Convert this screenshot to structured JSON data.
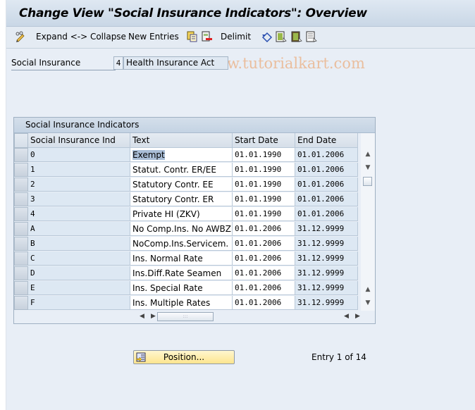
{
  "window": {
    "title": "Change View \"Social Insurance Indicators\": Overview"
  },
  "toolbar": {
    "items": [
      {
        "icon": "pencil-glasses-icon",
        "label": ""
      },
      {
        "label": "Expand <-> Collapse"
      },
      {
        "label": "New Entries"
      },
      {
        "icon": "copy-icon",
        "label": ""
      },
      {
        "icon": "delete-icon",
        "label": ""
      },
      {
        "label": "Delimit"
      },
      {
        "icon": "undo-icon",
        "label": ""
      },
      {
        "icon": "select-all-icon",
        "label": ""
      },
      {
        "icon": "select-block-icon",
        "label": ""
      },
      {
        "icon": "deselect-all-icon",
        "label": ""
      }
    ],
    "expand_collapse_label": "Expand <-> Collapse",
    "new_entries_label": "New Entries",
    "delimit_label": "Delimit"
  },
  "watermark": "©www.tutorialkart.com",
  "header_field": {
    "label": "Social Insurance",
    "key": "4",
    "value": "Health Insurance Act"
  },
  "table": {
    "title": "Social Insurance Indicators",
    "columns": [
      "Social Insurance Ind",
      "Text",
      "Start Date",
      "End Date"
    ],
    "rows": [
      {
        "ind": "0",
        "text": "Exempt",
        "start": "01.01.1990",
        "end": "01.01.2006"
      },
      {
        "ind": "1",
        "text": "Statut. Contr. ER/EE",
        "start": "01.01.1990",
        "end": "01.01.2006"
      },
      {
        "ind": "2",
        "text": "Statutory Contr. EE",
        "start": "01.01.1990",
        "end": "01.01.2006"
      },
      {
        "ind": "3",
        "text": "Statutory Contr. ER",
        "start": "01.01.1990",
        "end": "01.01.2006"
      },
      {
        "ind": "4",
        "text": "Private HI (ZKV)",
        "start": "01.01.1990",
        "end": "01.01.2006"
      },
      {
        "ind": "A",
        "text": "No Comp.Ins. No AWBZ",
        "start": "01.01.2006",
        "end": "31.12.9999"
      },
      {
        "ind": "B",
        "text": "NoComp.Ins.Servicem.",
        "start": "01.01.2006",
        "end": "31.12.9999"
      },
      {
        "ind": "C",
        "text": "Ins. Normal Rate",
        "start": "01.01.2006",
        "end": "31.12.9999"
      },
      {
        "ind": "D",
        "text": "Ins.Diff.Rate Seamen",
        "start": "01.01.2006",
        "end": "31.12.9999"
      },
      {
        "ind": "E",
        "text": "Ins. Special Rate",
        "start": "01.01.2006",
        "end": "31.12.9999"
      },
      {
        "ind": "F",
        "text": "Ins. Multiple Rates",
        "start": "01.01.2006",
        "end": "31.12.9999"
      }
    ]
  },
  "footer": {
    "position_button_label": "Position...",
    "entry_status": "Entry 1 of 14"
  }
}
